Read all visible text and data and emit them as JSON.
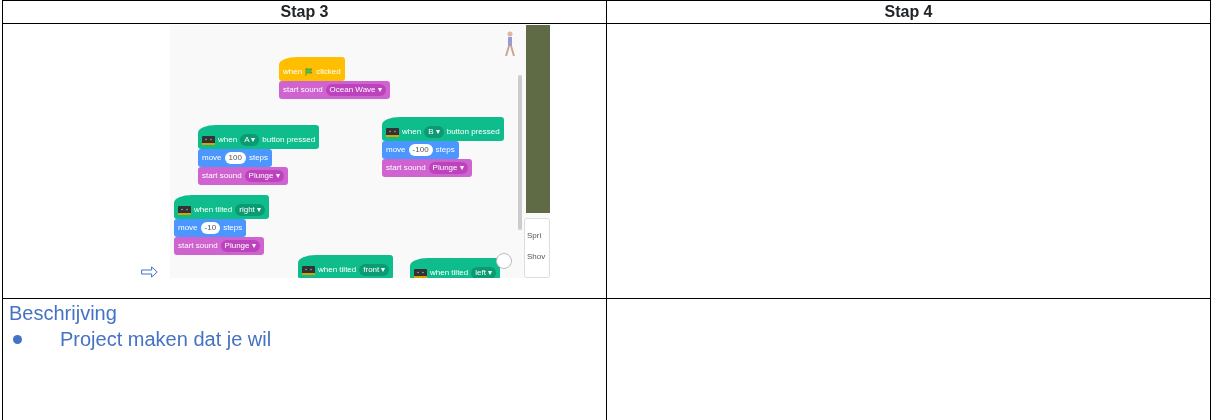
{
  "table": {
    "columns": [
      {
        "heading": "Stap 3",
        "screenshot": {
          "sprite_panel": [
            "Spri",
            "Shov"
          ],
          "scripts": [
            {
              "blocks": [
                {
                  "kind": "event",
                  "parts": [
                    {
                      "kind": "text",
                      "text": "when"
                    },
                    {
                      "kind": "flag"
                    },
                    {
                      "kind": "text",
                      "text": "clicked"
                    }
                  ]
                },
                {
                  "kind": "sound",
                  "parts": [
                    {
                      "kind": "text",
                      "text": "start sound"
                    },
                    {
                      "kind": "dropdown",
                      "text": "Ocean Wave ▾"
                    }
                  ]
                }
              ]
            },
            {
              "blocks": [
                {
                  "kind": "microbit",
                  "parts": [
                    {
                      "kind": "device"
                    },
                    {
                      "kind": "text",
                      "text": "when"
                    },
                    {
                      "kind": "dropdown",
                      "text": "A ▾"
                    },
                    {
                      "kind": "text",
                      "text": "button pressed"
                    }
                  ]
                },
                {
                  "kind": "motion",
                  "parts": [
                    {
                      "kind": "text",
                      "text": "move"
                    },
                    {
                      "kind": "number",
                      "text": "100"
                    },
                    {
                      "kind": "text",
                      "text": "steps"
                    }
                  ]
                },
                {
                  "kind": "sound",
                  "parts": [
                    {
                      "kind": "text",
                      "text": "start sound"
                    },
                    {
                      "kind": "dropdown",
                      "text": "Plunge ▾"
                    }
                  ]
                }
              ]
            },
            {
              "blocks": [
                {
                  "kind": "microbit",
                  "parts": [
                    {
                      "kind": "device"
                    },
                    {
                      "kind": "text",
                      "text": "when"
                    },
                    {
                      "kind": "dropdown",
                      "text": "B ▾"
                    },
                    {
                      "kind": "text",
                      "text": "button pressed"
                    }
                  ]
                },
                {
                  "kind": "motion",
                  "parts": [
                    {
                      "kind": "text",
                      "text": "move"
                    },
                    {
                      "kind": "number",
                      "text": "-100"
                    },
                    {
                      "kind": "text",
                      "text": "steps"
                    }
                  ]
                },
                {
                  "kind": "sound",
                  "parts": [
                    {
                      "kind": "text",
                      "text": "start sound"
                    },
                    {
                      "kind": "dropdown",
                      "text": "Plunge ▾"
                    }
                  ]
                }
              ]
            },
            {
              "blocks": [
                {
                  "kind": "microbit",
                  "parts": [
                    {
                      "kind": "device"
                    },
                    {
                      "kind": "text",
                      "text": "when tilted"
                    },
                    {
                      "kind": "dropdown",
                      "text": "right ▾"
                    }
                  ]
                },
                {
                  "kind": "motion",
                  "parts": [
                    {
                      "kind": "text",
                      "text": "move"
                    },
                    {
                      "kind": "number",
                      "text": "-10"
                    },
                    {
                      "kind": "text",
                      "text": "steps"
                    }
                  ]
                },
                {
                  "kind": "sound",
                  "parts": [
                    {
                      "kind": "text",
                      "text": "start sound"
                    },
                    {
                      "kind": "dropdown",
                      "text": "Plunge ▾"
                    }
                  ]
                }
              ]
            },
            {
              "blocks": [
                {
                  "kind": "microbit",
                  "parts": [
                    {
                      "kind": "device"
                    },
                    {
                      "kind": "text",
                      "text": "when tilted"
                    },
                    {
                      "kind": "dropdown",
                      "text": "front ▾"
                    }
                  ]
                }
              ]
            },
            {
              "blocks": [
                {
                  "kind": "microbit",
                  "parts": [
                    {
                      "kind": "device"
                    },
                    {
                      "kind": "text",
                      "text": "when tilted"
                    },
                    {
                      "kind": "dropdown",
                      "text": "left ▾"
                    }
                  ]
                }
              ]
            }
          ]
        }
      },
      {
        "heading": "Stap 4"
      }
    ]
  },
  "description": {
    "title": "Beschrijving",
    "bullets": [
      "Project maken dat je wil"
    ]
  }
}
